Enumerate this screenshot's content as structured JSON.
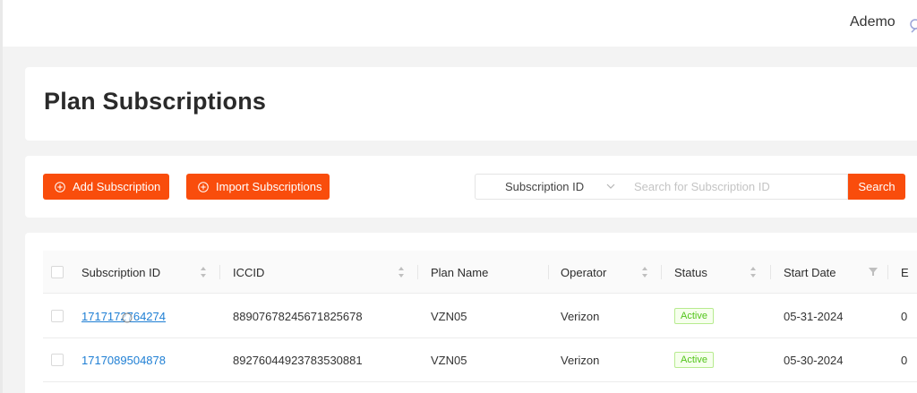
{
  "header": {
    "user_name": "Ademo"
  },
  "page": {
    "title": "Plan Subscriptions"
  },
  "toolbar": {
    "add_label": "Add Subscription",
    "import_label": "Import Subscriptions",
    "search_field_selected": "Subscription ID",
    "search_placeholder": "Search for Subscription ID",
    "search_label": "Search"
  },
  "table": {
    "columns": [
      "Subscription ID",
      "ICCID",
      "Plan Name",
      "Operator",
      "Status",
      "Start Date",
      "E"
    ],
    "rows": [
      {
        "subscription_id": "1717172764274",
        "iccid": "88907678245671825678",
        "plan_name": "VZN05",
        "operator": "Verizon",
        "status": "Active",
        "start_date": "05-31-2024",
        "end_partial": "0"
      },
      {
        "subscription_id": "1717089504878",
        "iccid": "89276044923783530881",
        "plan_name": "VZN05",
        "operator": "Verizon",
        "status": "Active",
        "start_date": "05-30-2024",
        "end_partial": "0"
      }
    ]
  },
  "colors": {
    "accent": "#f94d0c",
    "link": "#1f7fd4",
    "status_active": "#52c41a"
  }
}
